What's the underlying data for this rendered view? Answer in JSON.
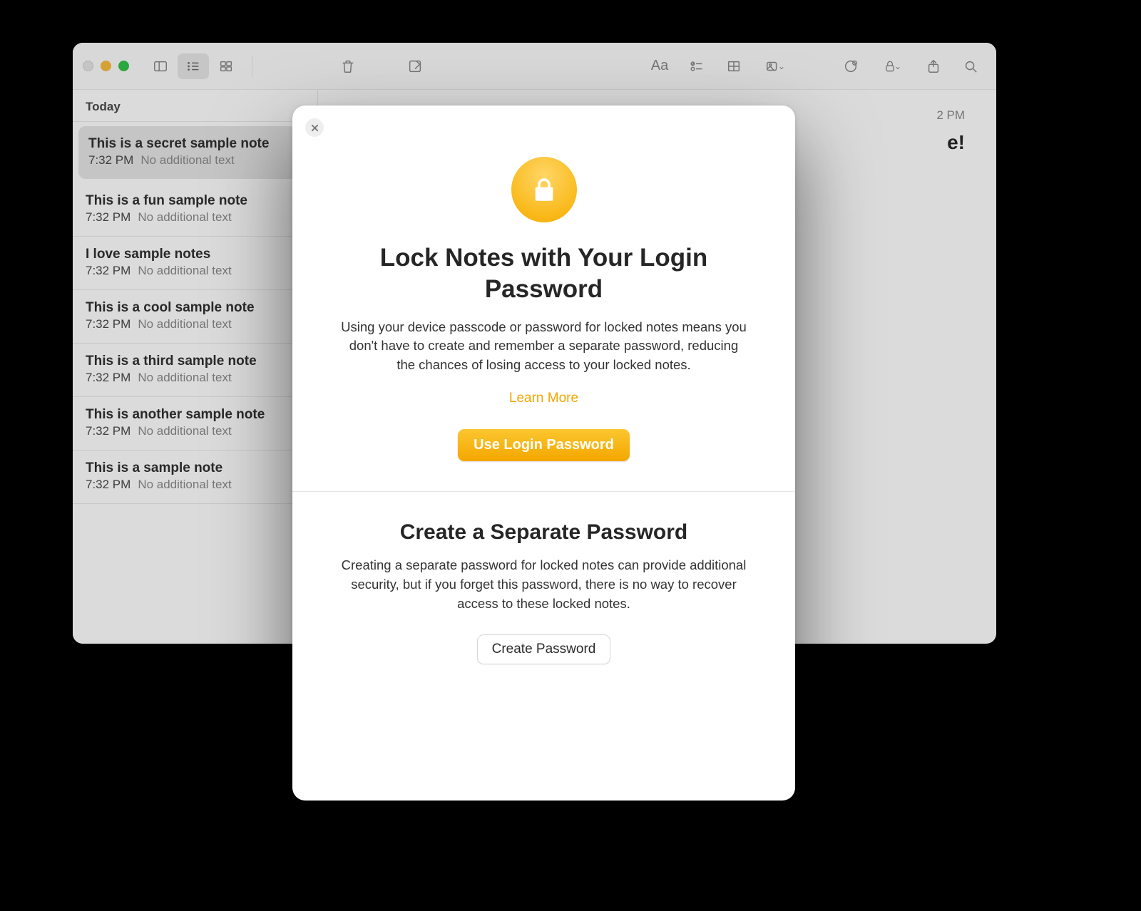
{
  "list": {
    "heading": "Today",
    "items": [
      {
        "title": "This is a secret sample note",
        "time": "7:32 PM",
        "preview": "No additional text",
        "selected": true
      },
      {
        "title": "This is a fun sample note",
        "time": "7:32 PM",
        "preview": "No additional text",
        "selected": false
      },
      {
        "title": "I love sample notes",
        "time": "7:32 PM",
        "preview": "No additional text",
        "selected": false
      },
      {
        "title": "This is a cool sample note",
        "time": "7:32 PM",
        "preview": "No additional text",
        "selected": false
      },
      {
        "title": "This is a third sample note",
        "time": "7:32 PM",
        "preview": "No additional text",
        "selected": false
      },
      {
        "title": "This is another sample note",
        "time": "7:32 PM",
        "preview": "No additional text",
        "selected": false
      },
      {
        "title": "This is a sample note",
        "time": "7:32 PM",
        "preview": "No additional text",
        "selected": false
      }
    ]
  },
  "editor": {
    "date_fragment": "2 PM",
    "title_fragment": "e!"
  },
  "modal": {
    "section1": {
      "heading": "Lock Notes with Your Login Password",
      "body": "Using your device passcode or password for locked notes means you don't have to create and remember a separate password, reducing the chances of losing access to your locked notes.",
      "learn_more": "Learn More",
      "primary": "Use Login Password"
    },
    "section2": {
      "heading": "Create a Separate Password",
      "body": "Creating a separate password for locked notes can provide additional security, but if you forget this password, there is no way to recover access to these locked notes.",
      "secondary": "Create Password"
    }
  },
  "colors": {
    "accent": "#f5a900"
  }
}
